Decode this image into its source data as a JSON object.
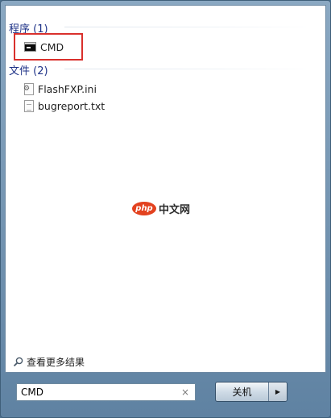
{
  "groups": [
    {
      "header": "程序 (1)",
      "items": [
        {
          "label": "CMD",
          "icon": "cmd-icon"
        }
      ]
    },
    {
      "header": "文件 (2)",
      "items": [
        {
          "label": "FlashFXP.ini",
          "icon": "ini-file-icon"
        },
        {
          "label": "bugreport.txt",
          "icon": "text-file-icon"
        }
      ]
    }
  ],
  "watermark": {
    "logo": "php",
    "text": "中文网"
  },
  "see_more": {
    "label": "查看更多结果",
    "icon": "search-icon"
  },
  "search": {
    "value": "CMD",
    "clear": "×"
  },
  "shutdown": {
    "label": "关机",
    "arrow": "▶"
  },
  "highlight_color": "#d9302c"
}
